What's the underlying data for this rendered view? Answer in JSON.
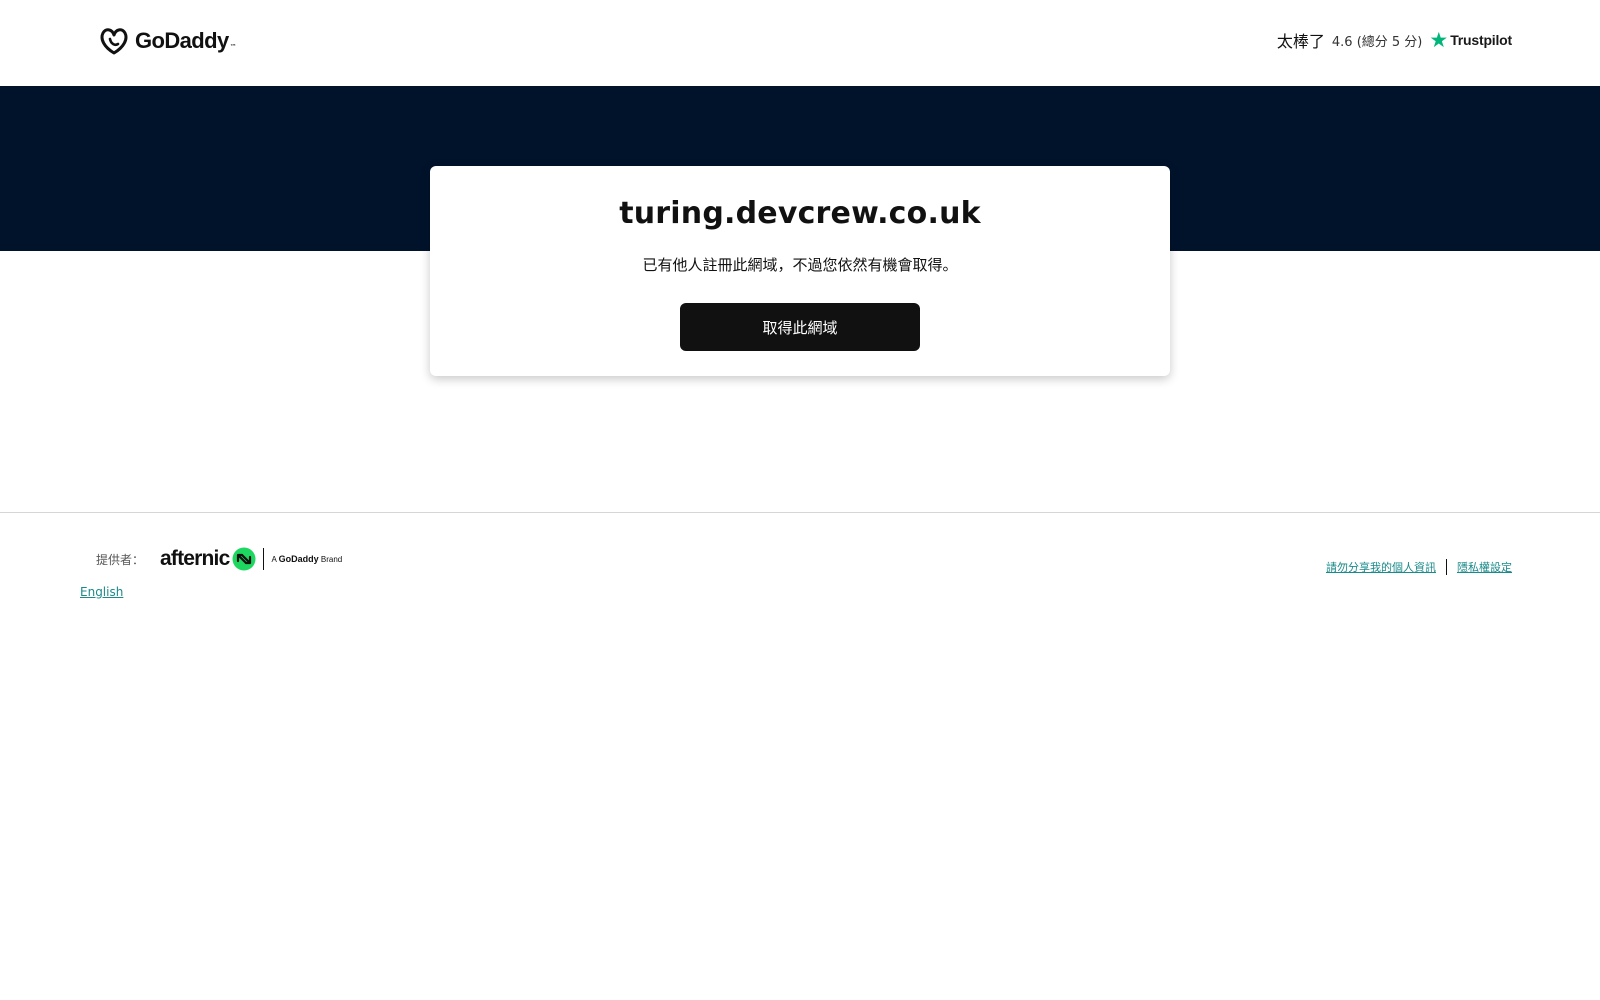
{
  "header": {
    "logo_text": "GoDaddy",
    "rating": {
      "word": "太棒了",
      "score": "4.6 (總分 5 分)",
      "provider": "Trustpilot"
    }
  },
  "card": {
    "domain": "turing.devcrew.co.uk",
    "message": "已有他人註冊此網域，不過您依然有機會取得。",
    "button_label": "取得此網域"
  },
  "footer": {
    "provider_label": "提供者：",
    "afternic_text": "afternic",
    "brand_prefix": "A",
    "brand_name": "GoDaddy",
    "brand_suffix": "Brand",
    "language_link": "English",
    "legal_links": [
      "請勿分享我的個人資訊",
      "隱私權設定"
    ]
  },
  "colors": {
    "hero_bg": "#00132b",
    "button_bg": "#111111",
    "link": "#1a8a8a",
    "trustpilot_green": "#00b67a",
    "afternic_green": "#1ed760"
  },
  "icons": {
    "logo": "godaddy-logo-icon",
    "trustpilot": "trustpilot-star-icon",
    "afternic": "afternic-arrows-icon"
  }
}
